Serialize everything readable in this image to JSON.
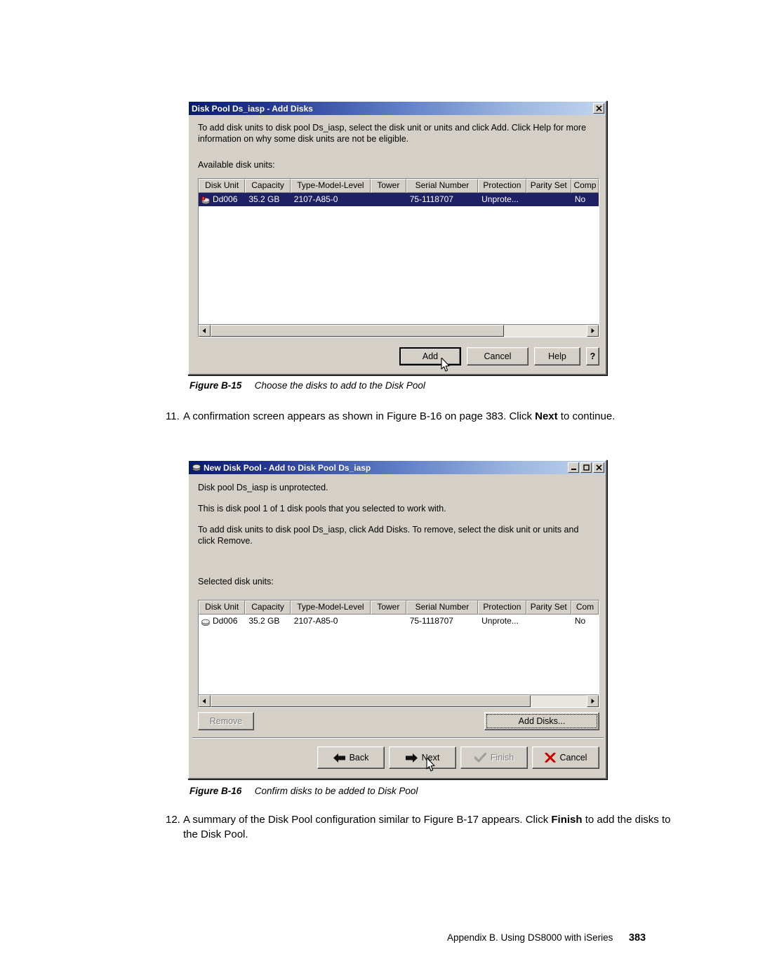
{
  "document": {
    "footer_text": "Appendix B. Using DS8000 with iSeries",
    "page_number": "383"
  },
  "figure15": {
    "caption_label": "Figure B-15",
    "caption_text": "Choose the disks to add to the Disk Pool",
    "dialog": {
      "title": "Disk Pool Ds_iasp - Add Disks",
      "close_label": "✕",
      "instruction": "To add disk units to disk pool Ds_iasp, select the disk unit or units and click Add. Click Help for more information on why some disk units are not be eligible.",
      "list_label": "Available disk units:",
      "columns": [
        "Disk Unit",
        "Capacity",
        "Type-Model-Level",
        "Tower",
        "Serial Number",
        "Protection",
        "Parity Set",
        "Comp"
      ],
      "rows": [
        {
          "selected": true,
          "icon": "disk-warning-icon",
          "cells": [
            "Dd006",
            "35.2 GB",
            "2107-A85-0",
            "",
            "75-1118707",
            "Unprote...",
            "",
            "No"
          ]
        }
      ],
      "buttons": {
        "add": "Add",
        "cancel": "Cancel",
        "help": "Help",
        "context_help": "?"
      }
    }
  },
  "step11": {
    "number": "11.",
    "text_before": "A confirmation screen appears as shown in Figure B-16 on page 383. Click ",
    "bold": "Next",
    "text_after": " to continue."
  },
  "figure16": {
    "caption_label": "Figure B-16",
    "caption_text": "Confirm disks to be added to Disk Pool",
    "dialog": {
      "title": "New Disk Pool - Add to Disk Pool Ds_iasp",
      "title_icon": "disk-icon",
      "minimize_label": "_",
      "maximize_label": "□",
      "close_label": "✕",
      "line1": "Disk pool Ds_iasp is unprotected.",
      "line2": "This is disk pool 1 of 1 disk pools that you selected to work with.",
      "line3": "To add disk units to disk pool Ds_iasp, click Add Disks. To remove, select the disk unit or units and click Remove.",
      "list_label": "Selected disk units:",
      "columns": [
        "Disk Unit",
        "Capacity",
        "Type-Model-Level",
        "Tower",
        "Serial Number",
        "Protection",
        "Parity Set",
        "Com"
      ],
      "rows": [
        {
          "selected": false,
          "icon": "disk-icon",
          "cells": [
            "Dd006",
            "35.2 GB",
            "2107-A85-0",
            "",
            "75-1118707",
            "Unprote...",
            "",
            "No"
          ]
        }
      ],
      "buttons": {
        "remove": "Remove",
        "remove_disabled": true,
        "add_disks": "Add Disks...",
        "back": "Back",
        "next": "Next",
        "finish": "Finish",
        "finish_disabled": true,
        "cancel": "Cancel"
      }
    }
  },
  "step12": {
    "number": "12.",
    "text_before": "A summary of the Disk Pool configuration similar to Figure B-17 appears. Click ",
    "bold": "Finish",
    "text_after": " to add the disks to the Disk Pool."
  },
  "colors": {
    "titlebar_start": "#0a1a6e",
    "titlebar_end": "#c3d5ef",
    "dialog_face": "#d4d0c8",
    "selection": "#1f1f63",
    "cancel_x": "#cc0000"
  }
}
